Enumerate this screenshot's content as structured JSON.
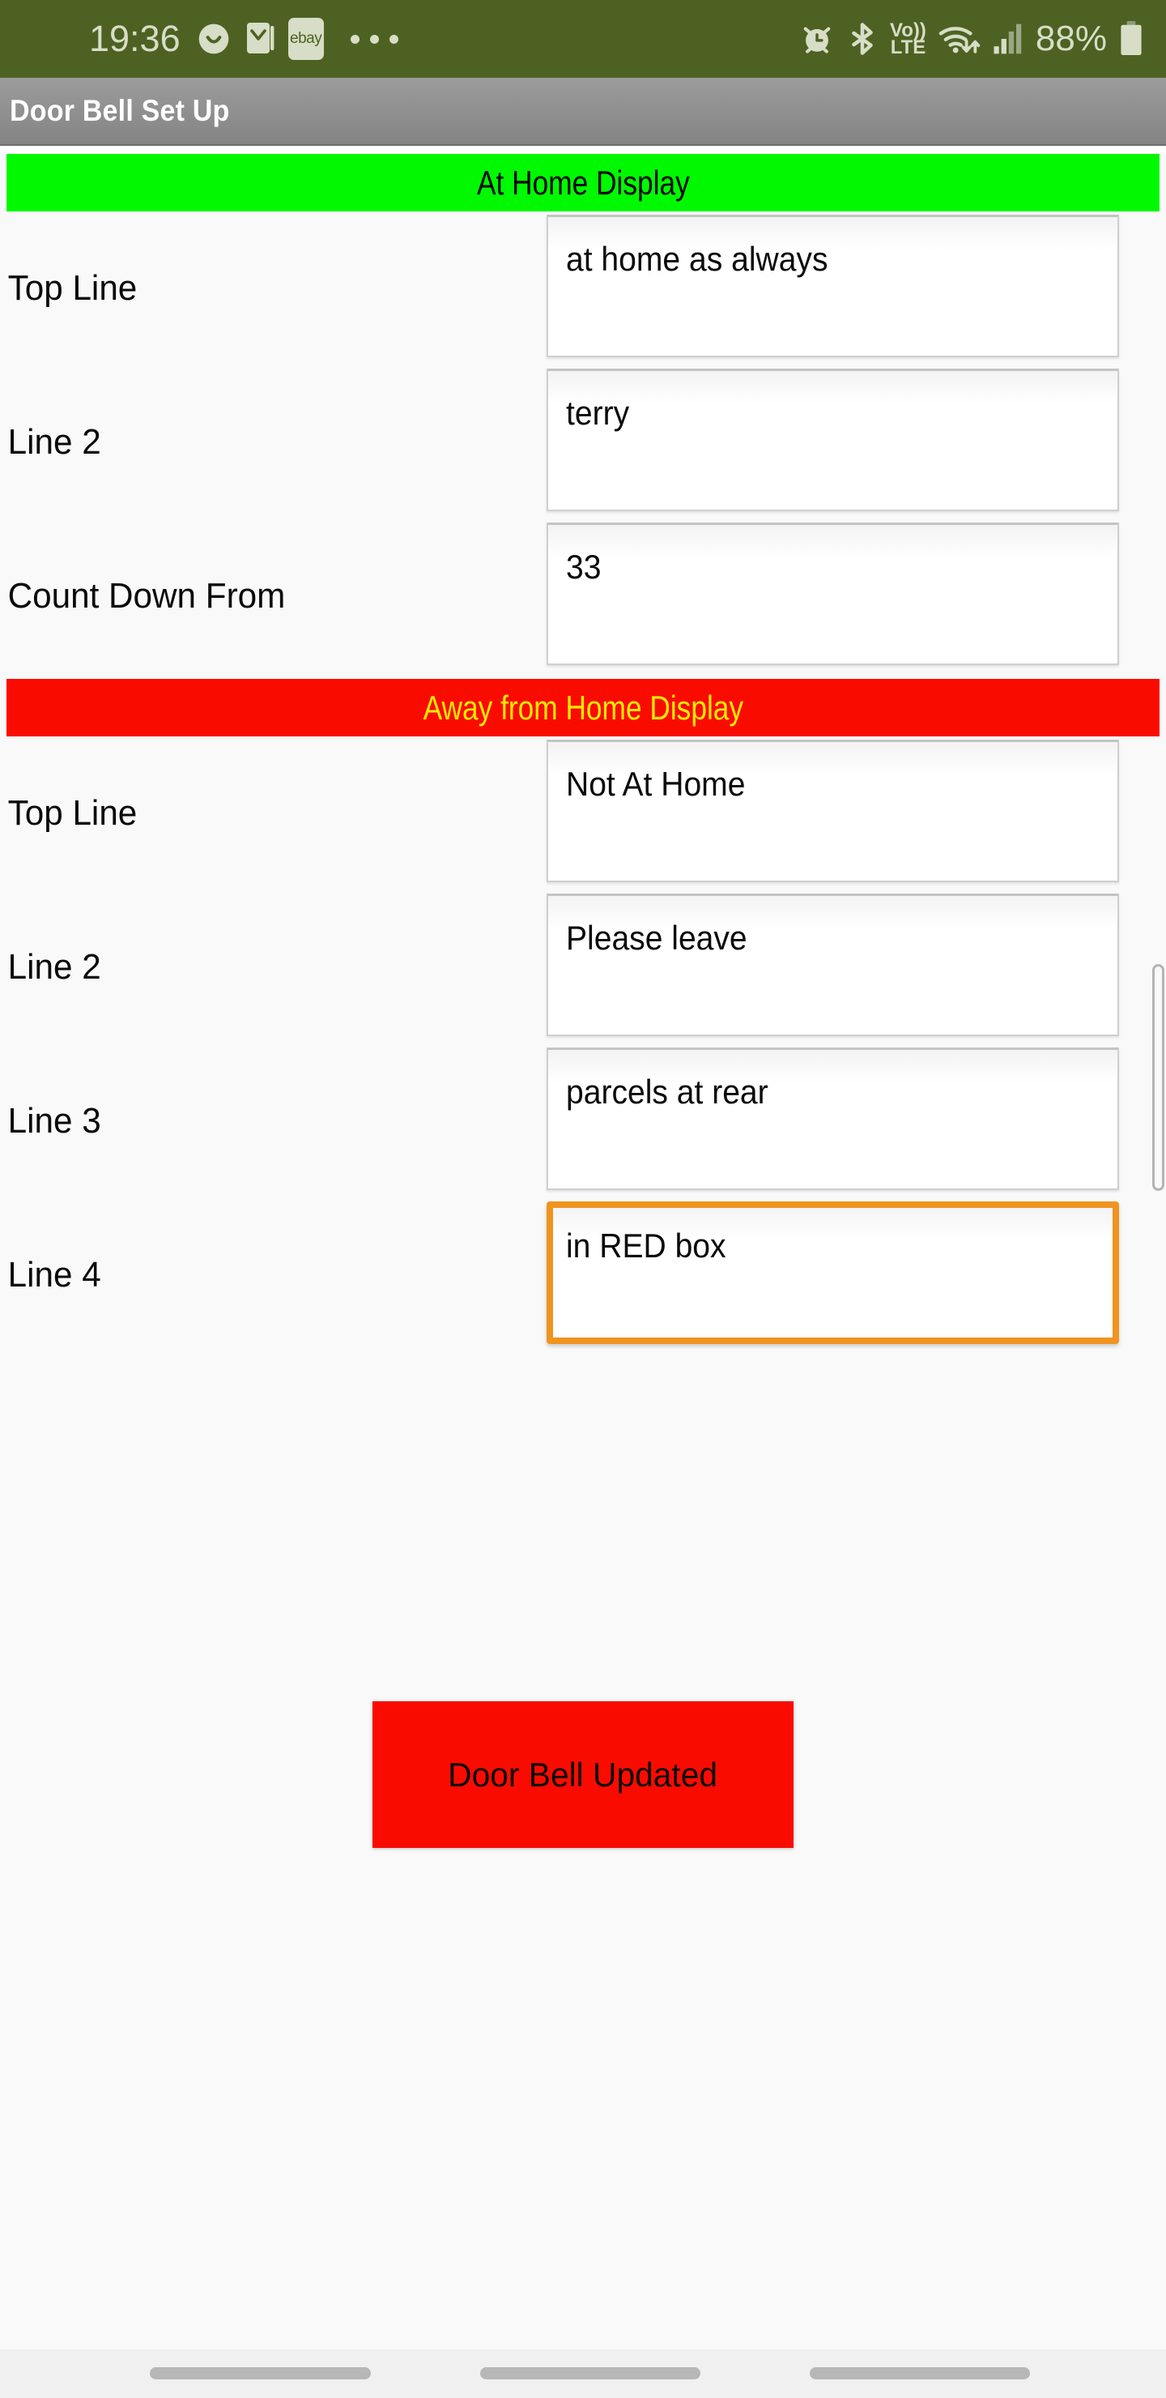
{
  "statusbar": {
    "time": "19:36",
    "battery_text": "88%",
    "volte_top": "Vo))",
    "volte_bottom": "LTE",
    "ebay_label": "ebay",
    "icons": [
      "smiley-face-icon",
      "mail-icon",
      "ebay-app-icon",
      "more-notifications-icon",
      "alarm-clock-icon",
      "bluetooth-icon",
      "volte-icon",
      "wifi-icon",
      "cellular-signal-icon",
      "battery-icon"
    ],
    "bg_color": "#4d6222",
    "fg_color": "#d7ddc6"
  },
  "titlebar": {
    "title": "Door Bell Set Up"
  },
  "sections": [
    {
      "id": "at-home",
      "header": "At Home Display",
      "header_bg": "#00f900",
      "header_fg": "#000000",
      "rows": [
        {
          "label": "Top Line",
          "value": "at home as always",
          "focused": false
        },
        {
          "label": "Line 2",
          "value": "terry",
          "focused": false
        },
        {
          "label": "Count Down From",
          "value": "33",
          "focused": false
        }
      ]
    },
    {
      "id": "away-from-home",
      "header": "Away from Home Display",
      "header_bg": "#fa0b00",
      "header_fg": "#ffec00",
      "rows": [
        {
          "label": "Top Line",
          "value": "Not At Home",
          "focused": false
        },
        {
          "label": "Line 2",
          "value": "Please leave",
          "focused": false
        },
        {
          "label": "Line 3",
          "value": "parcels at rear",
          "focused": false
        },
        {
          "label": "Line 4",
          "value": "in RED box",
          "focused": true
        }
      ]
    }
  ],
  "update_button": {
    "label": "Door Bell Updated",
    "bg_color": "#fa0b00",
    "fg_color": "#0a0a0a"
  },
  "focus_color": "#f0931f",
  "navbar": {
    "items": [
      "recents-key",
      "home-key",
      "back-key"
    ]
  }
}
